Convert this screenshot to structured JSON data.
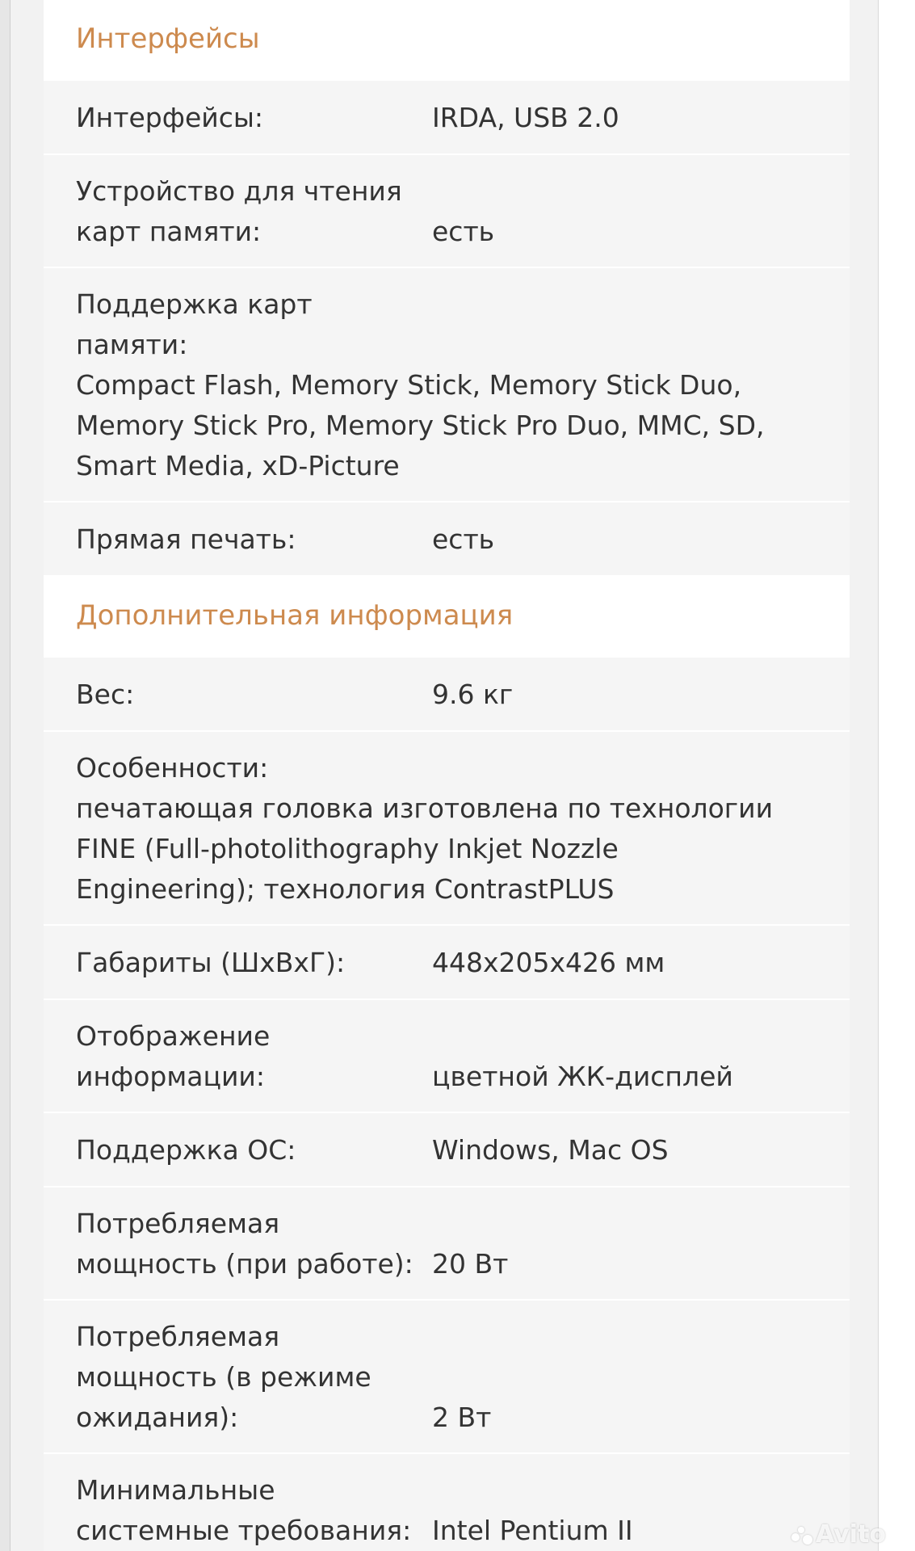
{
  "sections": [
    {
      "title": "Интерфейсы",
      "rows": [
        {
          "label": [
            "Интерфейсы:"
          ],
          "value": "IRDA, USB 2.0"
        },
        {
          "label": [
            "Устройство для чтения",
            "карт памяти:"
          ],
          "value": "есть"
        },
        {
          "label": [
            "Поддержка карт",
            "памяти:"
          ],
          "value_lines": [
            "Compact Flash, Memory Stick, Memory Stick Duo,",
            "Memory Stick Pro, Memory Stick Pro Duo, MMC, SD,",
            "Smart Media, xD-Picture"
          ]
        },
        {
          "label": [
            "Прямая печать:"
          ],
          "value": "есть"
        }
      ]
    },
    {
      "title": "Дополнительная информация",
      "rows": [
        {
          "label": [
            "Вес:"
          ],
          "value": "9.6 кг"
        },
        {
          "label": [
            "Особенности:"
          ],
          "value_lines": [
            "печатающая головка изготовлена по технологии",
            "FINE (Full-photolithography Inkjet Nozzle",
            "Engineering); технология ContrastPLUS"
          ]
        },
        {
          "label": [
            "Габариты (ШхВхГ):"
          ],
          "value": "448x205x426 мм"
        },
        {
          "label": [
            "Отображение",
            "информации:"
          ],
          "value": "цветной ЖК-дисплей"
        },
        {
          "label": [
            "Поддержка ОС:"
          ],
          "value": "Windows, Mac OS"
        },
        {
          "label": [
            "Потребляемая",
            "мощность (при работе):"
          ],
          "value": "20 Вт"
        },
        {
          "label": [
            "Потребляемая",
            "мощность (в режиме",
            "ожидания):"
          ],
          "value": "2 Вт"
        },
        {
          "label": [
            "Минимальные",
            "системные требования:"
          ],
          "value": "Intel Pentium II"
        }
      ]
    }
  ],
  "watermark": "Avito",
  "colors": {
    "section_title": "#cd8a4e",
    "row_bg": "#f5f5f5",
    "text": "#333333"
  }
}
